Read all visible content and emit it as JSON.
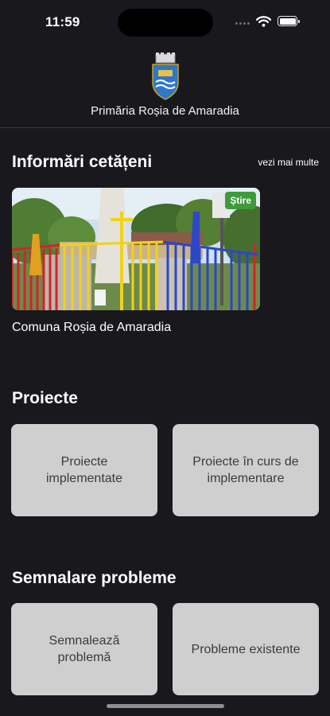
{
  "status_bar": {
    "time": "11:59"
  },
  "header": {
    "title": "Primăria Roșia de Amaradia"
  },
  "news": {
    "title": "Informări cetățeni",
    "see_more": "vezi mai multe",
    "card": {
      "badge": "Știre",
      "caption": "Comuna Roșia de Amaradia"
    }
  },
  "projects": {
    "title": "Proiecte",
    "tiles": [
      "Proiecte implementate",
      "Proiecte în curs de implementare"
    ]
  },
  "issues": {
    "title": "Semnalare probleme",
    "tiles": [
      "Semnalează problemă",
      "Probleme existente"
    ]
  },
  "colors": {
    "background": "#19181d",
    "tile": "#cfcfcf",
    "badge": "#3d9b3a"
  }
}
